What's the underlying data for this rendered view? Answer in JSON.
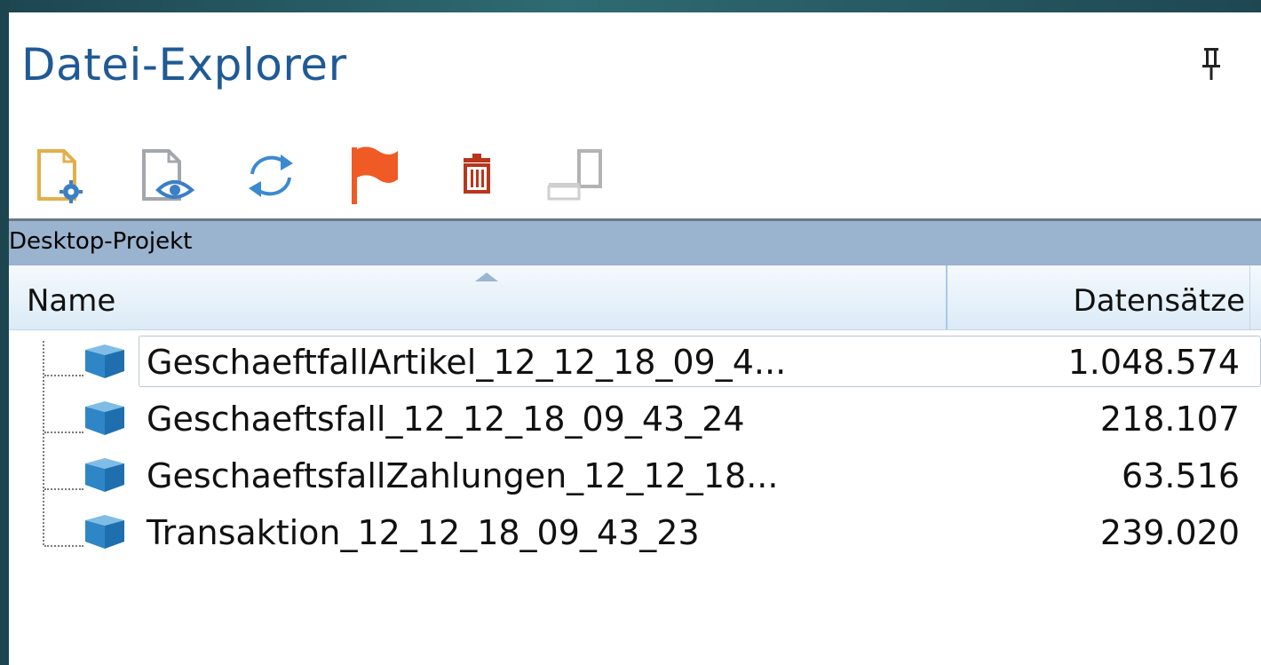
{
  "panel": {
    "title": "Datei-Explorer",
    "pin_icon": "pin-icon"
  },
  "toolbar": {
    "buttons": [
      {
        "icon": "file-settings-icon"
      },
      {
        "icon": "file-preview-icon"
      },
      {
        "icon": "refresh-icon"
      },
      {
        "icon": "flag-icon"
      },
      {
        "icon": "delete-icon"
      },
      {
        "icon": "window-toggle-icon"
      }
    ]
  },
  "project": {
    "label": "Desktop-Projekt"
  },
  "table": {
    "columns": [
      "Name",
      "Datensätze"
    ],
    "rows": [
      {
        "name": "GeschaeftfallArtikel_12_12_18_09_4...",
        "count": "1.048.574",
        "selected": true
      },
      {
        "name": "Geschaeftsfall_12_12_18_09_43_24",
        "count": "218.107",
        "selected": false
      },
      {
        "name": "GeschaeftsfallZahlungen_12_12_18...",
        "count": "63.516",
        "selected": false
      },
      {
        "name": "Transaktion_12_12_18_09_43_23",
        "count": "239.020",
        "selected": false
      }
    ]
  },
  "colors": {
    "title": "#1f5a96",
    "project_bar": "#9ab3ce",
    "flag": "#f05a24",
    "trash": "#b8361c",
    "cube": "#3a8fd0"
  }
}
